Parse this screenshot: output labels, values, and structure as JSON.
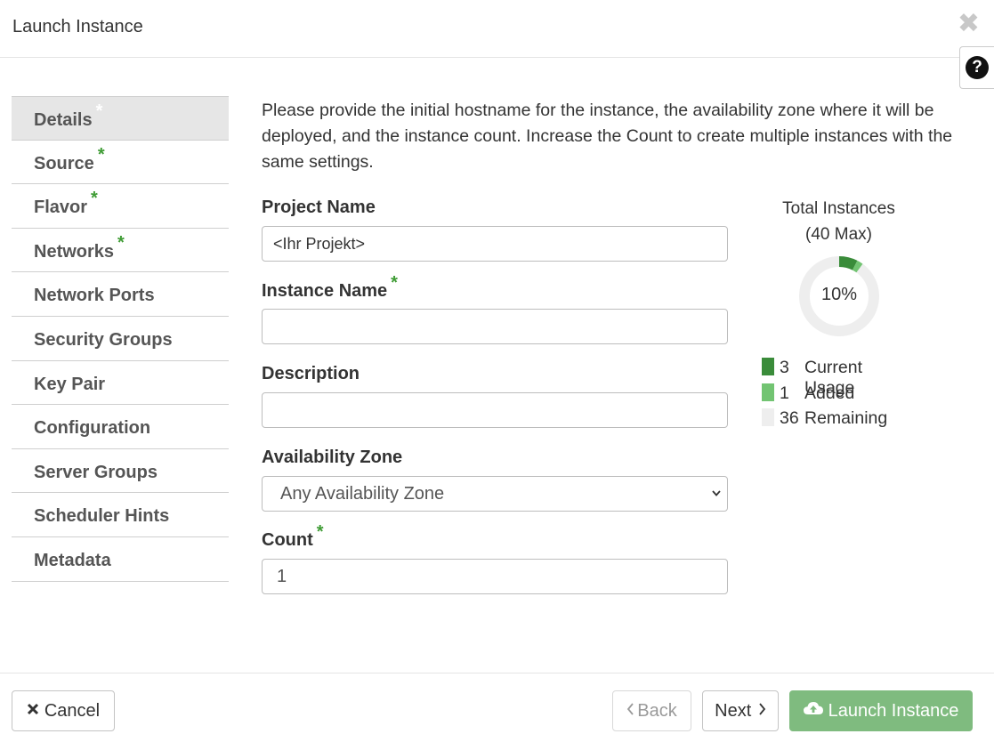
{
  "modal": {
    "title": "Launch Instance"
  },
  "nav": {
    "items": [
      {
        "label": "Details",
        "required": true
      },
      {
        "label": "Source",
        "required": true
      },
      {
        "label": "Flavor",
        "required": true
      },
      {
        "label": "Networks",
        "required": true
      },
      {
        "label": "Network Ports",
        "required": false
      },
      {
        "label": "Security Groups",
        "required": false
      },
      {
        "label": "Key Pair",
        "required": false
      },
      {
        "label": "Configuration",
        "required": false
      },
      {
        "label": "Server Groups",
        "required": false
      },
      {
        "label": "Scheduler Hints",
        "required": false
      },
      {
        "label": "Metadata",
        "required": false
      }
    ],
    "active": "Details",
    "required_mark": "*"
  },
  "intro_text": "Please provide the initial hostname for the instance, the availability zone where it will be deployed, and the instance count. Increase the Count to create multiple instances with the same settings.",
  "form": {
    "project_name": {
      "label": "Project Name",
      "value": "<Ihr Projekt>"
    },
    "instance_name": {
      "label": "Instance Name",
      "value": ""
    },
    "description": {
      "label": "Description",
      "value": ""
    },
    "availability_zone": {
      "label": "Availability Zone",
      "selected": "Any Availability Zone"
    },
    "count": {
      "label": "Count",
      "value": "1"
    }
  },
  "usage": {
    "title": "Total Instances",
    "max_label": "(40 Max)",
    "percent_label": "10%",
    "max": 40,
    "current": 3,
    "added": 1,
    "remaining": 36,
    "legend": [
      {
        "num": "3",
        "label": "Current Usage",
        "color": "#3a8c3a"
      },
      {
        "num": "1",
        "label": "Added",
        "color": "#72c472"
      },
      {
        "num": "36",
        "label": "Remaining",
        "color": "#eeeeee"
      }
    ]
  },
  "footer": {
    "cancel_label": "Cancel",
    "back_label": "Back",
    "next_label": "Next",
    "launch_label": "Launch Instance"
  },
  "icons": {
    "close": "close-icon",
    "help": "question-circle-icon",
    "cancel": "times-icon",
    "back": "chevron-left-icon",
    "next": "chevron-right-icon",
    "launch": "cloud-upload-icon"
  },
  "colors": {
    "required_star": "#3f9c35",
    "launch_button": "#7fbb7f",
    "active_nav_bg": "#e6e6e6"
  }
}
